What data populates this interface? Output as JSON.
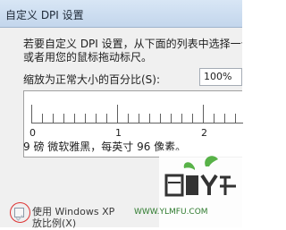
{
  "window": {
    "title": "自定义 DPI 设置"
  },
  "dialog": {
    "instruction_line1": "若要自定义 DPI 设置，从下面的列表中选择一个",
    "instruction_line2": "或者用您的鼠标拖动标尺。",
    "scale_label": "缩放为正常大小的百分比(S):",
    "scale_value": "100%",
    "ruler": {
      "labels": [
        "0",
        "1",
        "2"
      ]
    },
    "font_description": "9 磅 微软雅黑，每英寸 96 像素。",
    "xp_option": {
      "label_line1": "使用 Windows XP",
      "label_line2": "放比例(X)",
      "checked": true
    }
  },
  "watermark": {
    "text": "WWW.YLMFU.COM"
  }
}
